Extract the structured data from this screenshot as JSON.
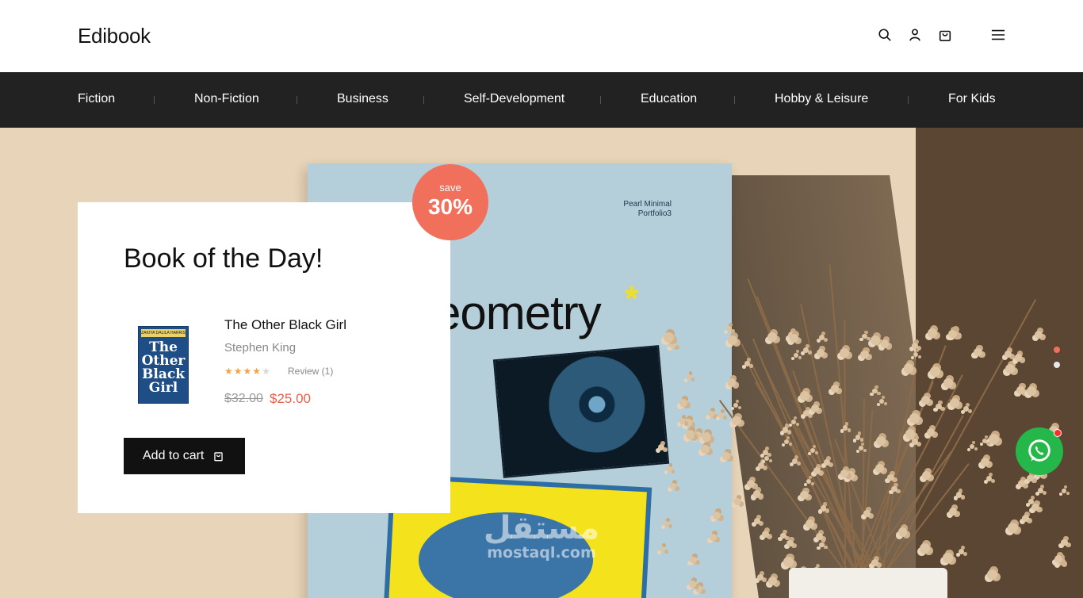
{
  "header": {
    "logo": "Edibook",
    "icons": [
      "search-icon",
      "user-icon",
      "bag-icon",
      "menu-icon"
    ]
  },
  "nav": {
    "items": [
      "Fiction",
      "Non-Fiction",
      "Business",
      "Self-Development",
      "Education",
      "Hobby & Leisure",
      "For Kids"
    ]
  },
  "hero": {
    "badge_top": "save",
    "badge_value": "30%",
    "book_publisher": "Pearl Minimal\nPortfolio3",
    "book_cover_title": "eometry",
    "book_cover_star": "*"
  },
  "card": {
    "title": "Book of the Day!",
    "book": {
      "cover_author": "ZAKIYA DALILA HARRIS",
      "cover_title": "The Other Black Girl",
      "title": "The Other Black Girl",
      "author": "Stephen King",
      "rating": 4,
      "rating_max": 5,
      "review": "Review (1)",
      "old_price": "$32.00",
      "price": "$25.00"
    },
    "add_to_cart": "Add to cart"
  },
  "slider": {
    "dots": 2,
    "active": 1
  },
  "watermark": {
    "arabic": "مستقل",
    "latin": "mostaql.com"
  },
  "colors": {
    "accent": "#f0705c",
    "price": "#e8604e",
    "nav_bg": "#222222",
    "whatsapp": "#25b74a"
  }
}
